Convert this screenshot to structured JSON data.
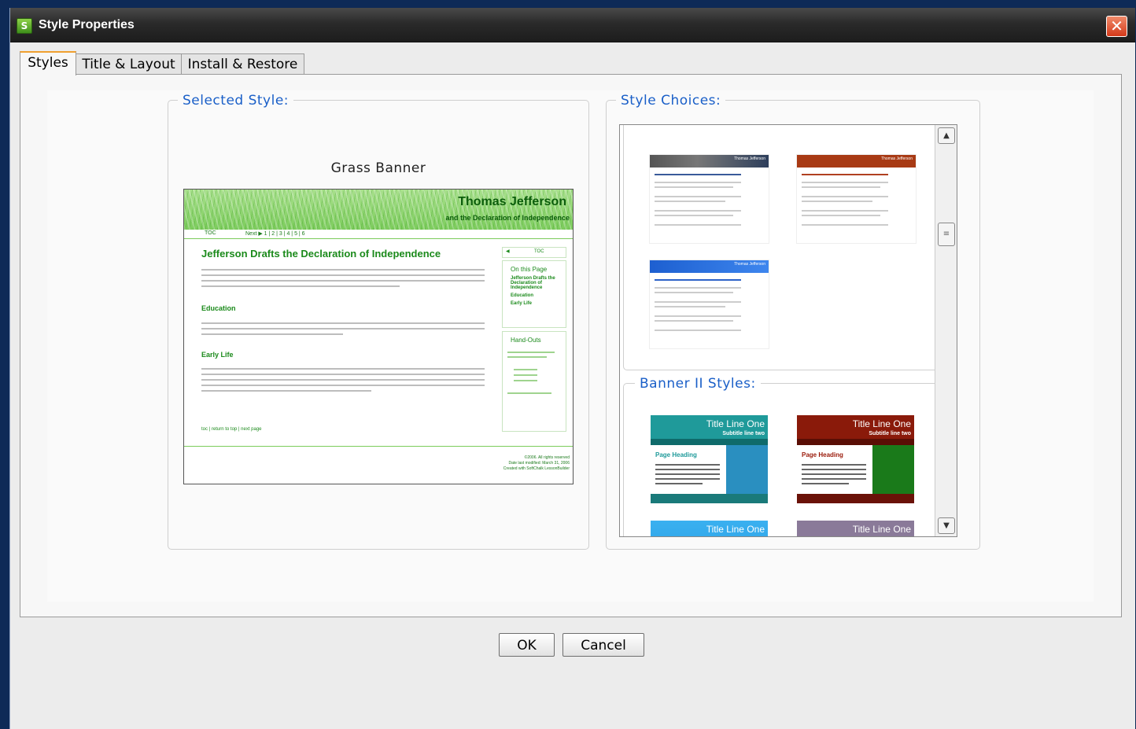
{
  "window": {
    "title": "Style Properties",
    "app_icon_text": "S"
  },
  "tabs": [
    {
      "label": "Styles",
      "active": true
    },
    {
      "label": "Title & Layout",
      "active": false
    },
    {
      "label": "Install & Restore",
      "active": false
    }
  ],
  "selected_style": {
    "legend": "Selected Style:",
    "name": "Grass Banner",
    "preview": {
      "banner_title": "Thomas Jefferson",
      "banner_subtitle": "and the Declaration of Independence",
      "nav_toc": "TOC",
      "nav_pages": "Next ▶  1 | 2 | 3 | 4 | 5 | 6",
      "heading": "Jefferson Drafts the Declaration of Independence",
      "sections": [
        "Education",
        "Early Life"
      ],
      "footer_links": "toc | return to top | next page",
      "footer_lines": [
        "©2006. All rights reserved",
        "Date last modified: March 31, 2006",
        "Created with SoftChalk LessonBuilder"
      ],
      "sidebar_box1_title": "On this Page",
      "sidebar_box1_items": [
        "Jefferson Drafts the Declaration of Independence",
        "Education",
        "Early Life"
      ],
      "sidebar_box2_title": "Hand-Outs",
      "sidebar_toc": "TOC"
    }
  },
  "style_choices": {
    "legend": "Style Choices:",
    "group2_legend": "Banner II Styles:",
    "banner_ii_thumbs": [
      {
        "title": "Title Line One",
        "subtitle": "Subtitle line two",
        "heading": "Page Heading",
        "color": "#1f9a9a"
      },
      {
        "title": "Title Line One",
        "subtitle": "Subtitle line two",
        "heading": "Page Heading",
        "color": "#8a1a0a"
      },
      {
        "title": "Title Line One",
        "color": "#1a8fd8"
      },
      {
        "title": "Title Line One",
        "color": "#8a7a99"
      }
    ],
    "thumb_titles": [
      "Thomas Jefferson",
      "Thomas Jefferson",
      "Thomas Jefferson"
    ]
  },
  "buttons": {
    "ok": "OK",
    "cancel": "Cancel"
  },
  "colors": {
    "accent_blue": "#1a5fc8",
    "grass_green": "#1b8a1b",
    "close_red": "#d4391a"
  }
}
